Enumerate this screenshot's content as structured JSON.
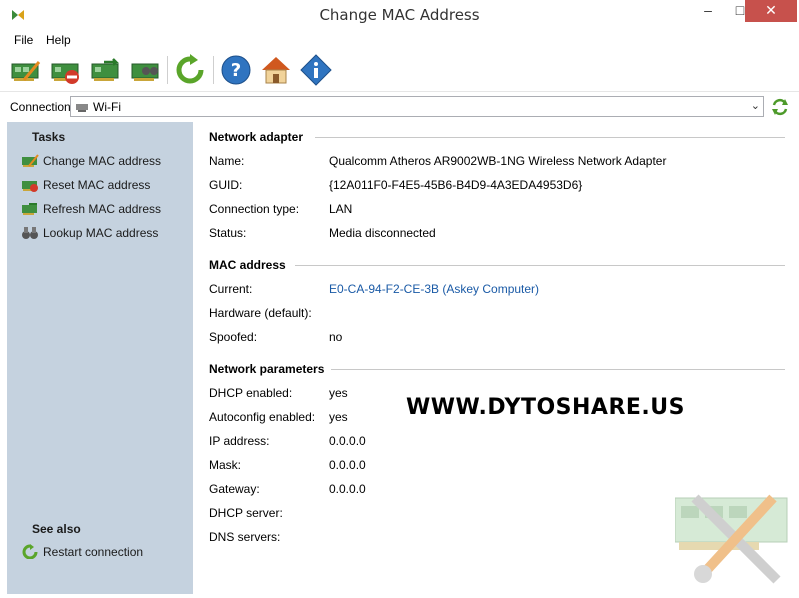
{
  "window": {
    "title": "Change MAC Address",
    "minimize": "–",
    "maximize": "□",
    "close": "✕"
  },
  "menu": {
    "items": [
      "File",
      "Help"
    ]
  },
  "toolbar": {
    "buttons": [
      "change-mac",
      "reset-mac",
      "refresh-mac",
      "lookup-mac",
      "restart-connection",
      "help",
      "home",
      "about"
    ]
  },
  "connection": {
    "label": "Connection:",
    "value": "Wi-Fi"
  },
  "sidebar": {
    "tasks_title": "Tasks",
    "tasks": [
      "Change MAC address",
      "Reset MAC address",
      "Refresh MAC address",
      "Lookup MAC address"
    ],
    "see_also_title": "See also",
    "see_also": [
      "Restart connection"
    ]
  },
  "network_adapter": {
    "title": "Network adapter",
    "name_label": "Name:",
    "name": "Qualcomm Atheros AR9002WB-1NG Wireless Network Adapter",
    "guid_label": "GUID:",
    "guid": "{12A011F0-F4E5-45B6-B4D9-4A3EDA4953D6}",
    "conn_type_label": "Connection type:",
    "conn_type": "LAN",
    "status_label": "Status:",
    "status": "Media disconnected"
  },
  "mac_address": {
    "title": "MAC address",
    "current_label": "Current:",
    "current": "E0-CA-94-F2-CE-3B (Askey Computer)",
    "hardware_label": "Hardware (default):",
    "hardware": "",
    "spoofed_label": "Spoofed:",
    "spoofed": "no"
  },
  "network_parameters": {
    "title": "Network parameters",
    "dhcp_label": "DHCP enabled:",
    "dhcp": "yes",
    "autoconfig_label": "Autoconfig enabled:",
    "autoconfig": "yes",
    "ip_label": "IP address:",
    "ip": "0.0.0.0",
    "mask_label": "Mask:",
    "mask": "0.0.0.0",
    "gateway_label": "Gateway:",
    "gateway": "0.0.0.0",
    "dhcp_server_label": "DHCP server:",
    "dhcp_server": "",
    "dns_label": "DNS servers:",
    "dns": ""
  },
  "watermark": "WWW.DYTOSHARE.US",
  "colors": {
    "sidebar": "#c5d2df",
    "link": "#1a5aa6",
    "close": "#c7514c"
  }
}
